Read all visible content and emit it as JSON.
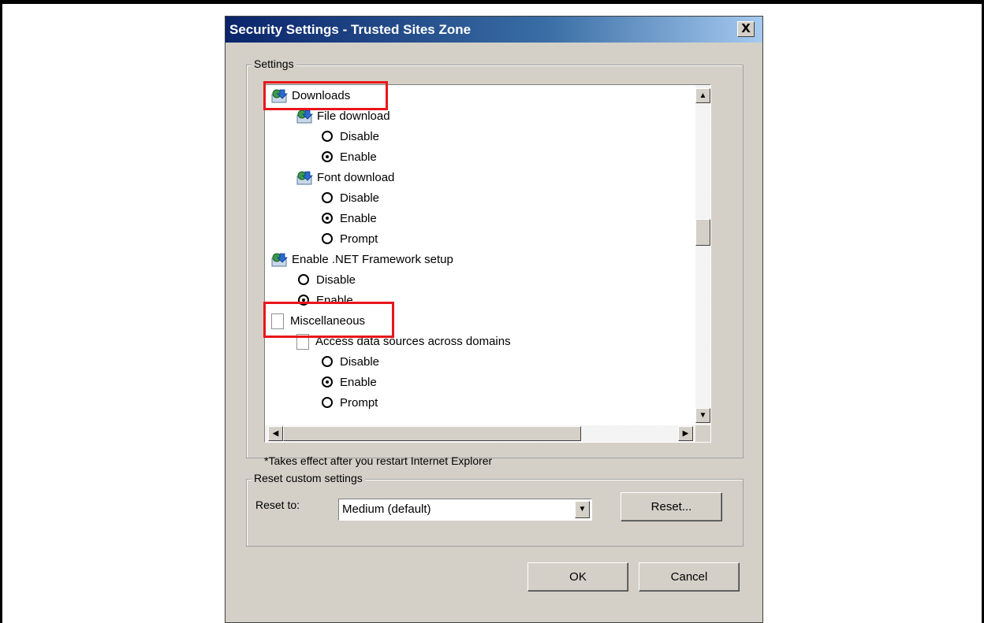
{
  "dialog": {
    "title": "Security Settings - Trusted Sites Zone",
    "close_label": "X"
  },
  "settings_group": {
    "label": "Settings",
    "items": [
      {
        "type": "category",
        "text": "Downloads",
        "icon": "download-icon"
      },
      {
        "type": "setting",
        "text": "File download",
        "icon": "download-icon"
      },
      {
        "type": "option",
        "text": "Disable",
        "selected": false
      },
      {
        "type": "option",
        "text": "Enable",
        "selected": true
      },
      {
        "type": "setting",
        "text": "Font download",
        "icon": "download-icon"
      },
      {
        "type": "option",
        "text": "Disable",
        "selected": false
      },
      {
        "type": "option",
        "text": "Enable",
        "selected": true
      },
      {
        "type": "option",
        "text": "Prompt",
        "selected": false
      },
      {
        "type": "setting",
        "text": "Enable .NET Framework setup",
        "icon": "download-icon"
      },
      {
        "type": "option",
        "text": "Disable",
        "selected": false
      },
      {
        "type": "option",
        "text": "Enable",
        "selected": true
      },
      {
        "type": "category",
        "text": "Miscellaneous",
        "icon": "document-icon"
      },
      {
        "type": "setting",
        "text": "Access data sources across domains",
        "icon": "document-icon"
      },
      {
        "type": "option",
        "text": "Disable",
        "selected": false
      },
      {
        "type": "option",
        "text": "Enable",
        "selected": true
      },
      {
        "type": "option",
        "text": "Prompt",
        "selected": false
      }
    ],
    "note": "*Takes effect after you restart Internet Explorer"
  },
  "reset_group": {
    "label": "Reset custom settings",
    "reset_to_label": "Reset to:",
    "selected_value": "Medium (default)",
    "reset_button": "Reset..."
  },
  "buttons": {
    "ok": "OK",
    "cancel": "Cancel"
  },
  "colors": {
    "highlight": "#e8161b",
    "title_bar": "#0a246a",
    "dialog_bg": "#d4d0c8"
  }
}
